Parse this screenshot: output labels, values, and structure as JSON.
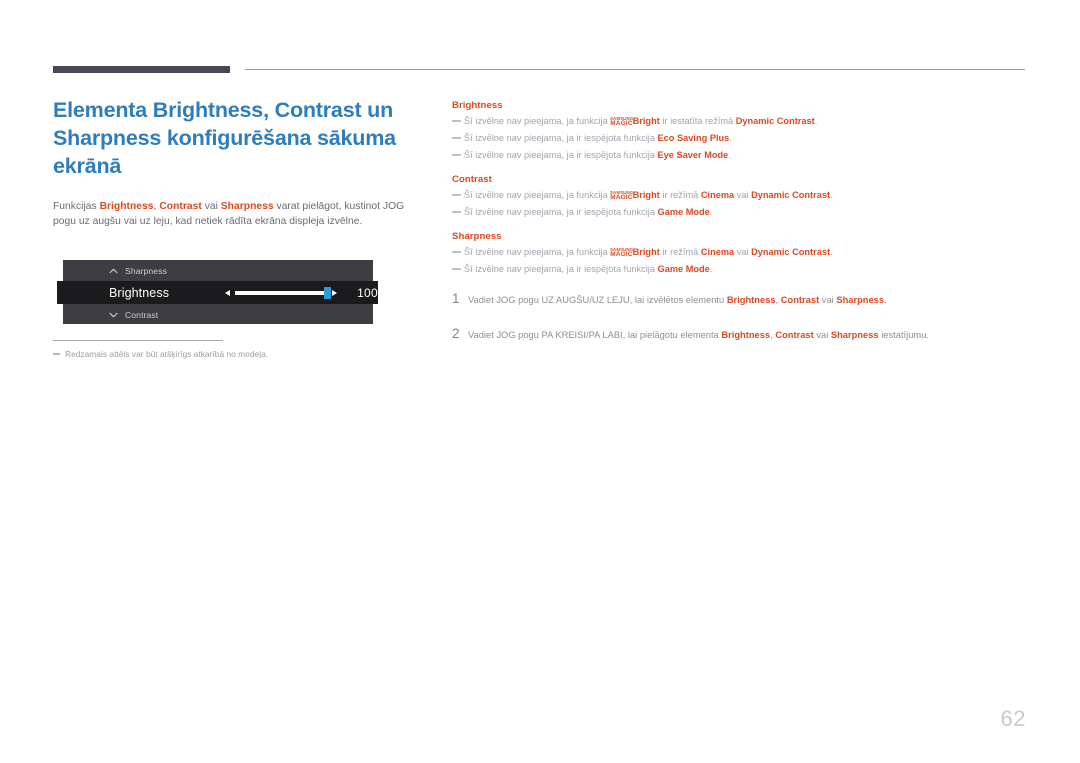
{
  "page": {
    "number": "62"
  },
  "title": "Elementa Brightness, Contrast un Sharpness konfigurēšana sākuma ekrānā",
  "intro": {
    "part1": "Funkcijas ",
    "hl1": "Brightness",
    "part2": ", ",
    "hl2": "Contrast",
    "part3": " vai ",
    "hl3": "Sharpness",
    "part4": " varat pielāgot, kustinot JOG pogu uz augšu vai uz leju, kad netiek rādīta ekrāna displeja izvēlne."
  },
  "osd": {
    "row_top": {
      "label": "Sharpness",
      "icon": "chevron-up-icon"
    },
    "row_selected": {
      "label": "Brightness",
      "value": "100",
      "slider_percent": 100
    },
    "row_bottom": {
      "label": "Contrast",
      "icon": "chevron-down-icon"
    },
    "arrow_left_icon": "arrow-left-icon",
    "arrow_right_icon": "arrow-right-icon"
  },
  "footnote": {
    "text": "Redzamais attēls var būt atšķirīgs atkarībā no modeļa."
  },
  "sections": [
    {
      "heading": "Brightness",
      "notes": [
        {
          "pre": "Šī izvēlne nav pieejama, ja funkcija ",
          "logo_top": "SAMSUNG",
          "logo_bottom": "MAGIC",
          "logo_word": "Bright",
          "mid": " ir iestatīta režīmā ",
          "hl_a": "Dynamic Contrast",
          "post": "."
        },
        {
          "pre": "Šī izvēlne nav pieejama, ja ir iespējota funkcija ",
          "hl_a": "Eco Saving Plus",
          "post": "."
        },
        {
          "pre": "Šī izvēlne nav pieejama, ja ir iespējota funkcija ",
          "hl_a": "Eye Saver Mode",
          "post": "."
        }
      ]
    },
    {
      "heading": "Contrast",
      "notes": [
        {
          "pre": "Šī izvēlne nav pieejama, ja funkcija ",
          "logo_top": "SAMSUNG",
          "logo_bottom": "MAGIC",
          "logo_word": "Bright",
          "mid": " ir režīmā ",
          "hl_a": "Cinema",
          "sep": " vai ",
          "hl_b": "Dynamic Contrast",
          "post": "."
        },
        {
          "pre": "Šī izvēlne nav pieejama, ja ir iespējota funkcija ",
          "hl_a": "Game Mode",
          "post": "."
        }
      ]
    },
    {
      "heading": "Sharpness",
      "notes": [
        {
          "pre": "Šī izvēlne nav pieejama, ja funkcija ",
          "logo_top": "SAMSUNG",
          "logo_bottom": "MAGIC",
          "logo_word": "Bright",
          "mid": " ir režīmā ",
          "hl_a": "Cinema",
          "sep": " vai ",
          "hl_b": "Dynamic Contrast",
          "post": "."
        },
        {
          "pre": "Šī izvēlne nav pieejama, ja ir iespējota funkcija ",
          "hl_a": "Game Mode",
          "post": "."
        }
      ]
    }
  ],
  "steps": [
    {
      "num": "1",
      "pre": "Vadiet JOG pogu UZ AUGŠU/UZ LEJU, lai izvēlētos elementu ",
      "hl_a": "Brightness",
      "sep1": ", ",
      "hl_b": "Contrast",
      "sep2": " vai ",
      "hl_c": "Sharpness",
      "post": "."
    },
    {
      "num": "2",
      "pre": "Vadiet JOG pogu PA KREISI/PA LABI, lai pielāgotu elementa ",
      "hl_a": "Brightness",
      "sep1": ", ",
      "hl_b": "Contrast",
      "sep2": " vai ",
      "hl_c": "Sharpness",
      "post": " iestatījumu."
    }
  ],
  "colors": {
    "title_blue": "#2f7dbd",
    "accent_orange": "#dd4820",
    "header_bar": "#4a4657",
    "osd_panel": "#3e3e42",
    "osd_selected": "#1b1b1d",
    "slider_handle": "#2e9bd6"
  }
}
